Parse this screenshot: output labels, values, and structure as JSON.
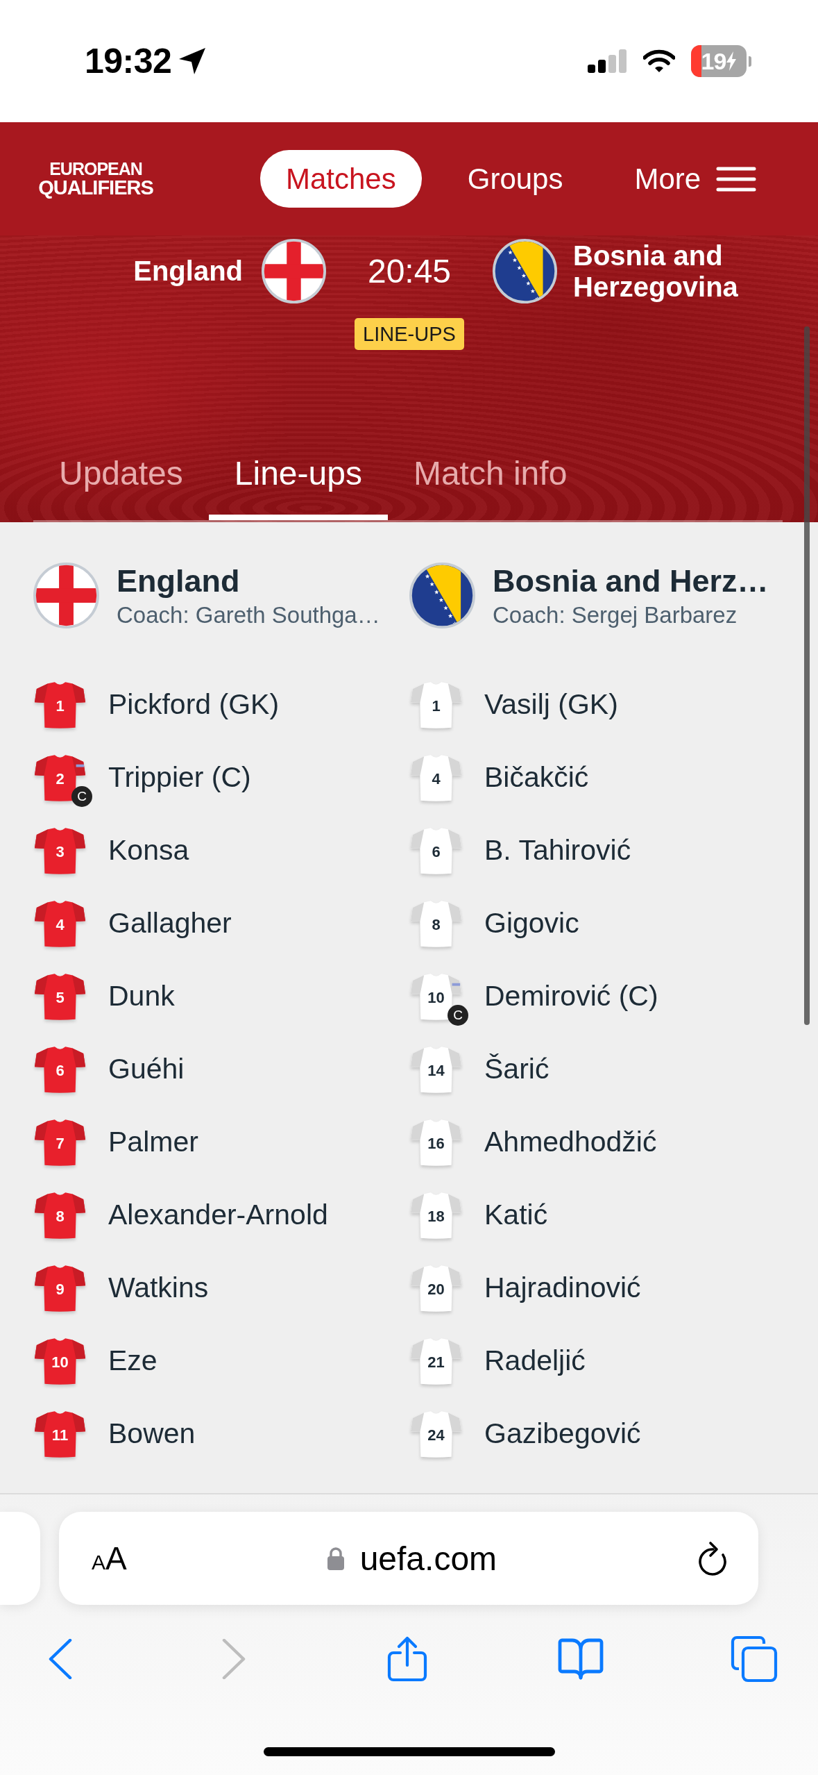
{
  "status_bar": {
    "time": "19:32",
    "battery": "19"
  },
  "nav": {
    "logo": {
      "top": "EUROPEAN",
      "bottom": "QUALIFIERS"
    },
    "items": [
      {
        "label": "Matches",
        "selected": true,
        "kind": "link"
      },
      {
        "label": "Groups",
        "selected": false,
        "kind": "link"
      },
      {
        "label": "More",
        "selected": false,
        "kind": "menu"
      }
    ]
  },
  "match": {
    "teams": [
      {
        "name": "England"
      },
      {
        "name": "Bosnia and Herzegovina"
      }
    ],
    "time": "20:45",
    "status": "LINE-UPS"
  },
  "tabs": [
    {
      "label": "Updates",
      "selected": false
    },
    {
      "label": "Line-ups",
      "selected": true
    },
    {
      "label": "Match info",
      "selected": false
    }
  ],
  "lineups": {
    "teams": [
      {
        "name": "England",
        "coach": "Coach: Gareth Southga…",
        "color": "#e8202c",
        "players": [
          {
            "number": "1",
            "name": "Pickford (GK)"
          },
          {
            "number": "2",
            "name": "Trippier (C)",
            "badge": "C"
          },
          {
            "number": "3",
            "name": "Konsa"
          },
          {
            "number": "4",
            "name": "Gallagher"
          },
          {
            "number": "5",
            "name": "Dunk"
          },
          {
            "number": "6",
            "name": "Guéhi"
          },
          {
            "number": "7",
            "name": "Palmer"
          },
          {
            "number": "8",
            "name": "Alexander-Arnold"
          },
          {
            "number": "9",
            "name": "Watkins"
          },
          {
            "number": "10",
            "name": "Eze"
          },
          {
            "number": "11",
            "name": "Bowen"
          }
        ]
      },
      {
        "name": "Bosnia and Herz…",
        "coach": "Coach: Sergej Barbarez",
        "color": "#ffffff",
        "players": [
          {
            "number": "1",
            "name": "Vasilj (GK)"
          },
          {
            "number": "4",
            "name": "Bičakčić"
          },
          {
            "number": "6",
            "name": "B. Tahirović"
          },
          {
            "number": "8",
            "name": "Gigovic"
          },
          {
            "number": "10",
            "name": "Demirović (C)",
            "badge": "C"
          },
          {
            "number": "14",
            "name": "Šarić"
          },
          {
            "number": "16",
            "name": "Ahmedhodžić"
          },
          {
            "number": "18",
            "name": "Katić"
          },
          {
            "number": "20",
            "name": "Hajradinović"
          },
          {
            "number": "21",
            "name": "Radeljić"
          },
          {
            "number": "24",
            "name": "Gazibegović"
          }
        ]
      }
    ]
  },
  "browser": {
    "page_menu": {
      "small": "A",
      "large": "A"
    },
    "url": "uefa.com"
  }
}
